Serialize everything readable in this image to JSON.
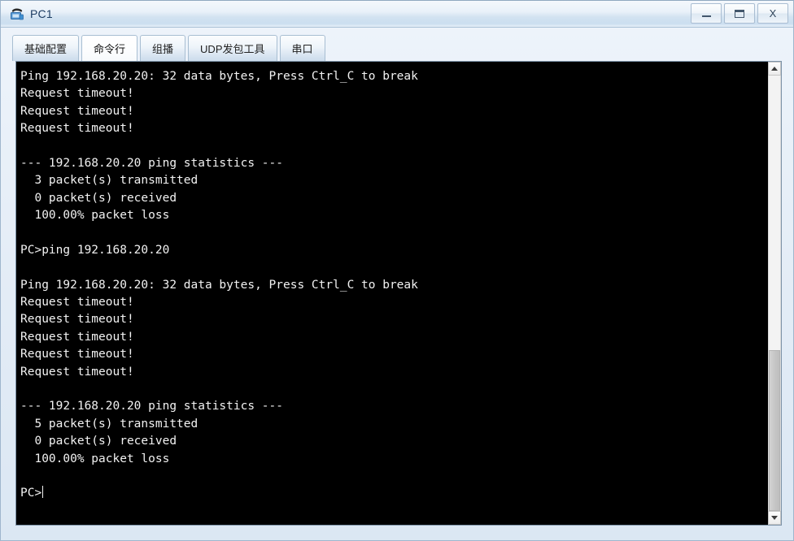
{
  "window": {
    "title": "PC1",
    "icon": "pc-monitor-icon",
    "buttons": {
      "minimize": "minimize-icon",
      "maximize": "maximize-icon",
      "close": "X"
    }
  },
  "tabs": [
    {
      "label": "基础配置",
      "active": false
    },
    {
      "label": "命令行",
      "active": true
    },
    {
      "label": "组播",
      "active": false
    },
    {
      "label": "UDP发包工具",
      "active": false
    },
    {
      "label": "串口",
      "active": false
    }
  ],
  "console": {
    "background_color": "#000000",
    "text_color": "#f2f2f2",
    "prompt": "PC>",
    "cursor_visible": true,
    "lines": [
      "Ping 192.168.20.20: 32 data bytes, Press Ctrl_C to break",
      "Request timeout!",
      "Request timeout!",
      "Request timeout!",
      "",
      "--- 192.168.20.20 ping statistics ---",
      "  3 packet(s) transmitted",
      "  0 packet(s) received",
      "  100.00% packet loss",
      "",
      "PC>ping 192.168.20.20",
      "",
      "Ping 192.168.20.20: 32 data bytes, Press Ctrl_C to break",
      "Request timeout!",
      "Request timeout!",
      "Request timeout!",
      "Request timeout!",
      "Request timeout!",
      "",
      "--- 192.168.20.20 ping statistics ---",
      "  5 packet(s) transmitted",
      "  0 packet(s) received",
      "  100.00% packet loss",
      "",
      "PC>"
    ]
  },
  "scrollbar": {
    "up_arrow": "chevron-up-icon",
    "down_arrow": "chevron-down-icon",
    "thumb_top_percent": 63,
    "thumb_height_percent": 37
  }
}
